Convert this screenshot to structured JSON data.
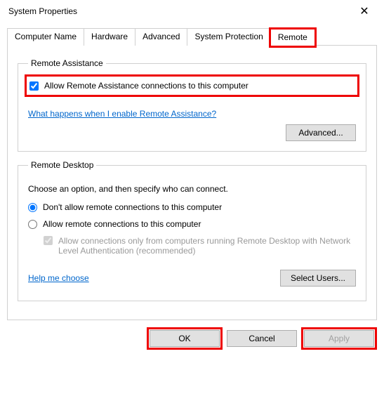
{
  "window": {
    "title": "System Properties"
  },
  "tabs": {
    "t0": "Computer Name",
    "t1": "Hardware",
    "t2": "Advanced",
    "t3": "System Protection",
    "t4": "Remote"
  },
  "remoteAssistance": {
    "legend": "Remote Assistance",
    "allowLabel": "Allow Remote Assistance connections to this computer",
    "allowChecked": true,
    "helpLink": "What happens when I enable Remote Assistance?",
    "advancedBtn": "Advanced..."
  },
  "remoteDesktop": {
    "legend": "Remote Desktop",
    "instruction": "Choose an option, and then specify who can connect.",
    "opt1": "Don't allow remote connections to this computer",
    "opt2": "Allow remote connections to this computer",
    "nlaLabel": "Allow connections only from computers running Remote Desktop with Network Level Authentication (recommended)",
    "nlaChecked": true,
    "helpLink": "Help me choose",
    "selectUsersBtn": "Select Users..."
  },
  "buttons": {
    "ok": "OK",
    "cancel": "Cancel",
    "apply": "Apply"
  }
}
